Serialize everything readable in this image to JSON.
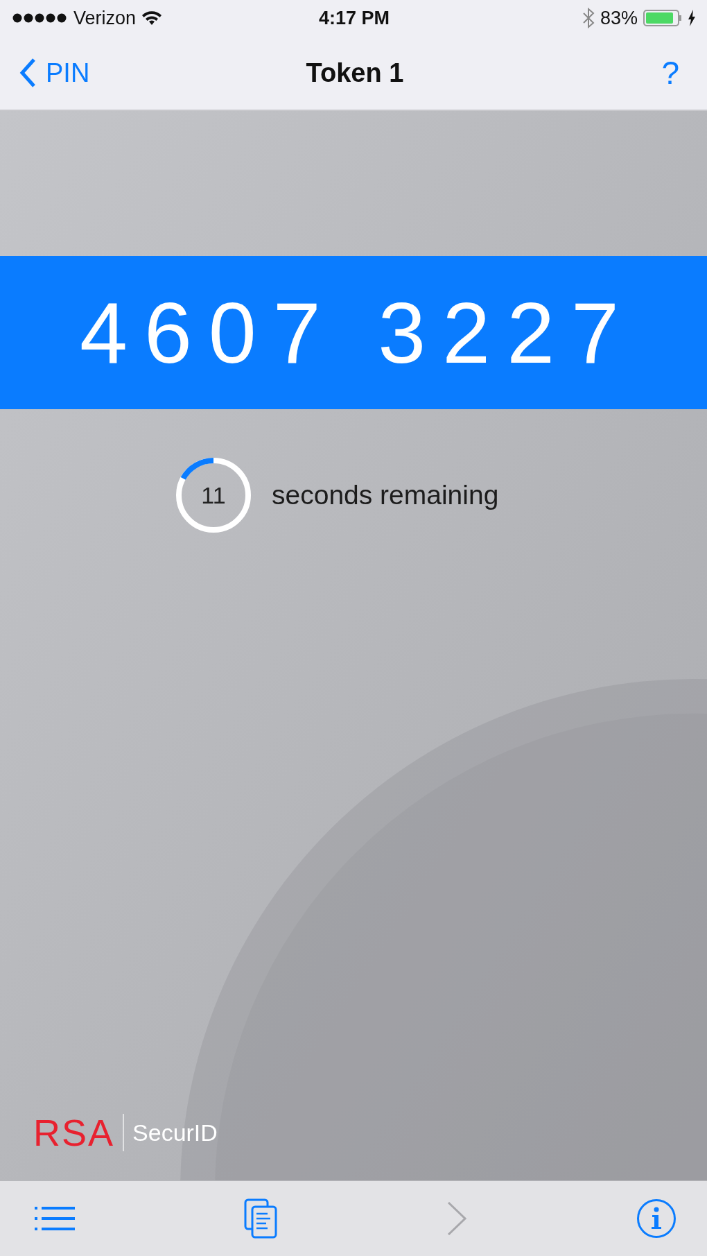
{
  "status_bar": {
    "carrier": "Verizon",
    "time": "4:17 PM",
    "battery": "83%"
  },
  "nav_bar": {
    "back": "PIN",
    "title": "Token 1",
    "help": "?"
  },
  "token": {
    "code": "4607 3227",
    "timer": {
      "count": "11",
      "label": "seconds remaining",
      "level": 0.17
    }
  },
  "logo": {
    "brand": "RSA",
    "product": "SecurID"
  },
  "toolbar": [
    {
      "kind": "list",
      "disabled": false
    },
    {
      "kind": "copy",
      "disabled": false
    },
    {
      "kind": "next",
      "disabled": true
    },
    {
      "kind": "info",
      "disabled": false
    }
  ]
}
